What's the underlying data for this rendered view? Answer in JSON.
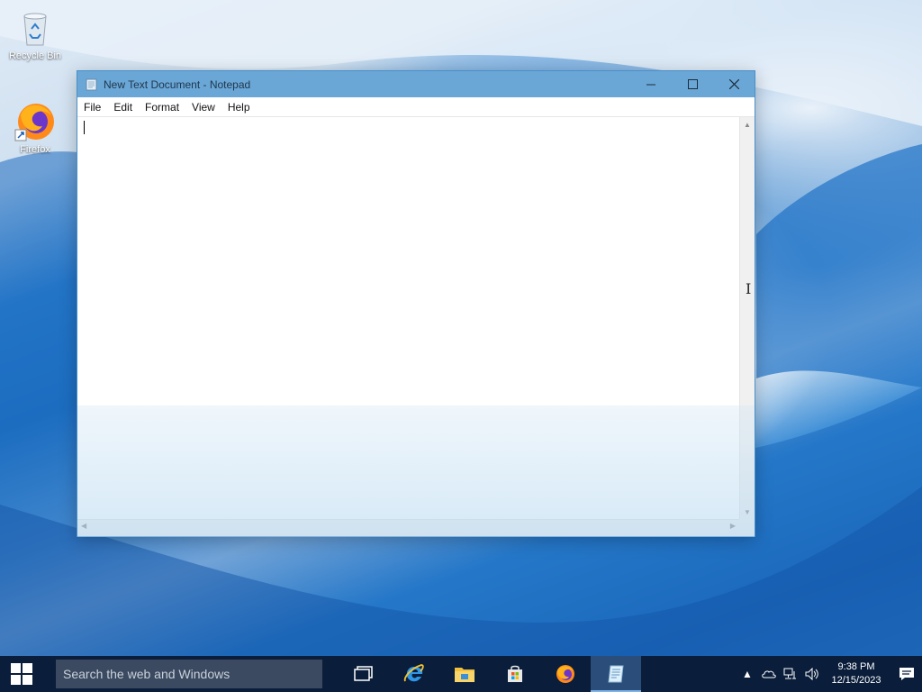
{
  "desktop": {
    "icons": [
      {
        "label": "Recycle Bin",
        "icon": "recycle-bin-icon"
      },
      {
        "label": "Firefox",
        "icon": "firefox-icon"
      }
    ]
  },
  "notepad": {
    "title": "New Text Document - Notepad",
    "menu": [
      "File",
      "Edit",
      "Format",
      "View",
      "Help"
    ],
    "content": ""
  },
  "taskbar": {
    "search_placeholder": "Search the web and Windows",
    "pinned": [
      "task-view-icon",
      "internet-explorer-icon",
      "file-explorer-icon",
      "store-icon",
      "firefox-icon",
      "notepad-icon"
    ],
    "active_app": "notepad-icon",
    "clock": {
      "time": "9:38 PM",
      "date": "12/15/2023"
    }
  },
  "colors": {
    "titlebar": "#6aa7d6",
    "taskbar": "#0a1d3a",
    "search_box": "#3b4a60"
  }
}
